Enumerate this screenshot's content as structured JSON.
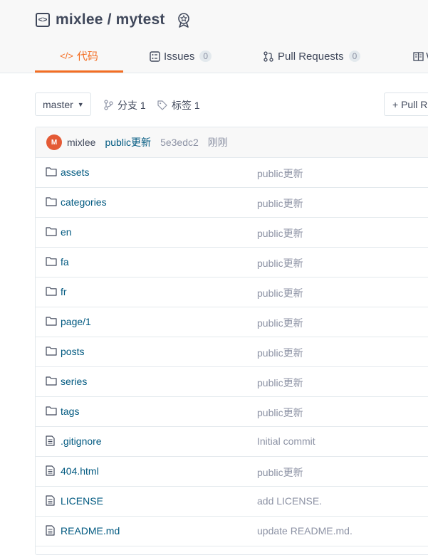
{
  "repo": {
    "title": "mixlee / mytest"
  },
  "tabs": [
    {
      "label": "代码",
      "icon": "code-icon"
    },
    {
      "label": "Issues",
      "count": "0",
      "icon": "issues-icon"
    },
    {
      "label": "Pull Requests",
      "count": "0",
      "icon": "pull-request-icon"
    },
    {
      "label": "W",
      "icon": "wiki-icon"
    }
  ],
  "toolbar": {
    "branch": "master",
    "branches_label": "分支 1",
    "tags_label": "标签 1",
    "pr_button": "+ Pull R"
  },
  "commit": {
    "avatar_letter": "M",
    "author": "mixlee",
    "message": "public更新",
    "sha": "5e3edc2",
    "time": "刚刚"
  },
  "files": [
    {
      "name": "assets",
      "type": "folder",
      "message": "public更新"
    },
    {
      "name": "categories",
      "type": "folder",
      "message": "public更新"
    },
    {
      "name": "en",
      "type": "folder",
      "message": "public更新"
    },
    {
      "name": "fa",
      "type": "folder",
      "message": "public更新"
    },
    {
      "name": "fr",
      "type": "folder",
      "message": "public更新"
    },
    {
      "name": "page/1",
      "type": "folder",
      "message": "public更新"
    },
    {
      "name": "posts",
      "type": "folder",
      "message": "public更新"
    },
    {
      "name": "series",
      "type": "folder",
      "message": "public更新"
    },
    {
      "name": "tags",
      "type": "folder",
      "message": "public更新"
    },
    {
      "name": ".gitignore",
      "type": "file",
      "message": "Initial commit"
    },
    {
      "name": "404.html",
      "type": "file",
      "message": "public更新"
    },
    {
      "name": "LICENSE",
      "type": "file",
      "message": "add LICENSE."
    },
    {
      "name": "README.md",
      "type": "file",
      "message": "update README.md."
    }
  ],
  "colors": {
    "accent": "#f36e23",
    "link": "#005980",
    "muted": "#8c92a4",
    "avatar": "#e45a35"
  }
}
